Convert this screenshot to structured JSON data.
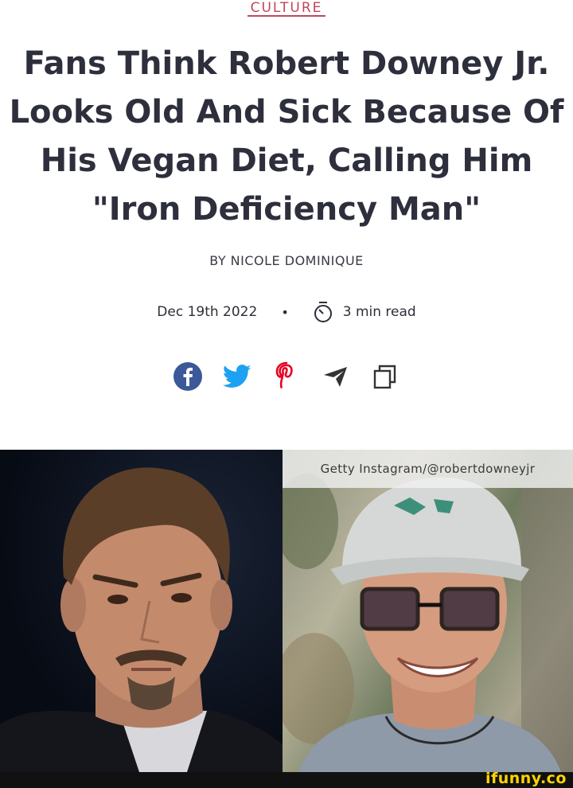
{
  "article": {
    "category": "CULTURE",
    "headline": "Fans Think Robert Downey Jr. Looks Old And Sick Because Of His Vegan Diet, Calling Him \"Iron Deficiency Man\"",
    "byline": "BY NICOLE DOMINIQUE",
    "date": "Dec 19th 2022",
    "separator": "•",
    "read_time": "3 min read"
  },
  "share": {
    "icons": [
      "facebook-icon",
      "twitter-icon",
      "pinterest-icon",
      "telegram-icon",
      "copy-icon"
    ],
    "colors": {
      "facebook": "#3b5998",
      "twitter": "#1da1f2",
      "pinterest": "#e60023",
      "neutral": "#333333"
    }
  },
  "image": {
    "credit": "Getty Instagram/@robertdowneyjr"
  },
  "watermark": {
    "text": "ifunny.co"
  },
  "colors": {
    "accent": "#c0475c",
    "headline": "#2e2f3c"
  }
}
